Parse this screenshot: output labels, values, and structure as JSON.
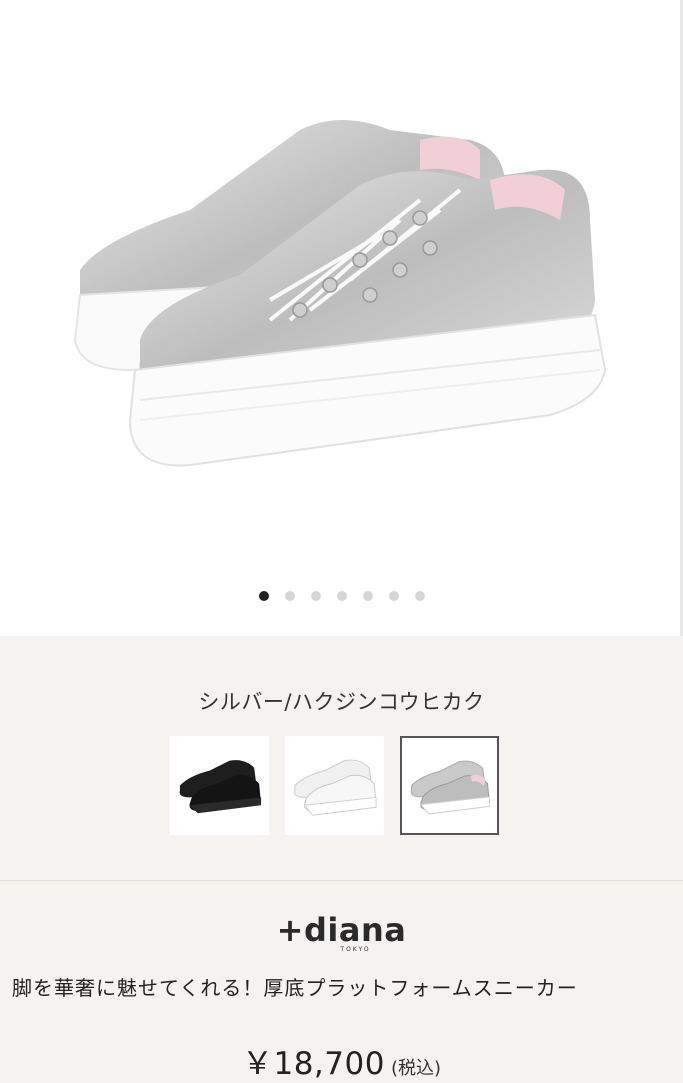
{
  "gallery": {
    "image_alt": "Silver platform sneakers",
    "dot_count": 7,
    "active_index": 0
  },
  "color": {
    "selected_label": "シルバー/ハクジンコウヒカク",
    "swatches": [
      {
        "name": "black",
        "selected": false
      },
      {
        "name": "white",
        "selected": false
      },
      {
        "name": "silver",
        "selected": true
      }
    ]
  },
  "brand": {
    "name": "+diana",
    "sub": "TOKYO"
  },
  "product": {
    "title": "脚を華奢に魅せてくれる！厚底プラットフォームスニーカー",
    "price": "￥18,700",
    "tax_note": "(税込)"
  },
  "colors": {
    "dot_active": "#222222",
    "dot_inactive": "#d6d6d6",
    "swatch_border": "#555555",
    "background": "#f5f3f0"
  }
}
